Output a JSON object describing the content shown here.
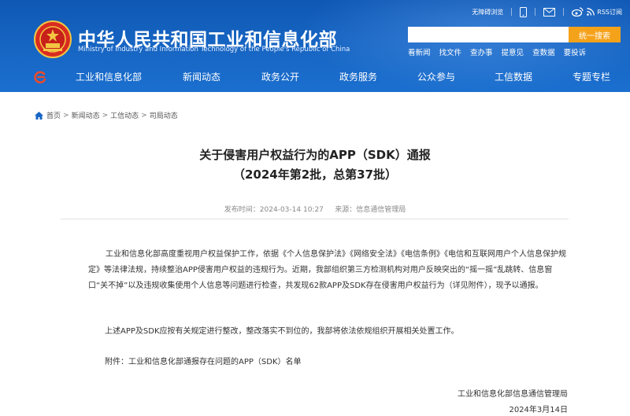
{
  "site": {
    "title": "中华人民共和国工业和信息化部",
    "subtitle": "Ministry of Industry and Information Technology of the People's Republic of China"
  },
  "top_tools": {
    "accessible_label": "无障碍浏览",
    "rss_label": "RSS订阅"
  },
  "search": {
    "placeholder": "",
    "button_label": "统一搜索"
  },
  "quick_links": [
    "看新闻",
    "找文件",
    "查办事",
    "提意见",
    "查数据",
    "要投诉"
  ],
  "nav": {
    "items": [
      "工业和信息化部",
      "新闻动态",
      "政务公开",
      "政务服务",
      "公众参与",
      "工信数据",
      "专题专栏"
    ]
  },
  "breadcrumb": [
    "首页",
    "新闻动态",
    "工信动态",
    "司局动态"
  ],
  "article": {
    "title_line1": "关于侵害用户权益行为的APP（SDK）通报",
    "title_line2": "（2024年第2批，总第37批）",
    "meta": "发布时间：2024-03-14 10:27     来源：信息通信管理局",
    "para1": "工业和信息化部高度重视用户权益保护工作，依据《个人信息保护法》《网络安全法》《电信条例》《电信和互联网用户个人信息保护规定》等法律法规，持续整治APP侵害用户权益的违规行为。近期，我部组织第三方检测机构对用户反映突出的“摇一摇”乱跳转、信息窗口“关不掉”以及违规收集使用个人信息等问题进行检查，共发现62款APP及SDK存在侵害用户权益行为（详见附件），现予以通报。",
    "para2": "上述APP及SDK应按有关规定进行整改，整改落实不到位的，我部将依法依规组织开展相关处置工作。",
    "para3": "附件：工业和信息化部通报存在问题的APP（SDK）名单",
    "sign_org": "工业和信息化部信息通信管理局",
    "sign_date": "2024年3月14日"
  },
  "colors": {
    "header_blue": "#1766c4",
    "search_orange": "#f5a21b"
  }
}
